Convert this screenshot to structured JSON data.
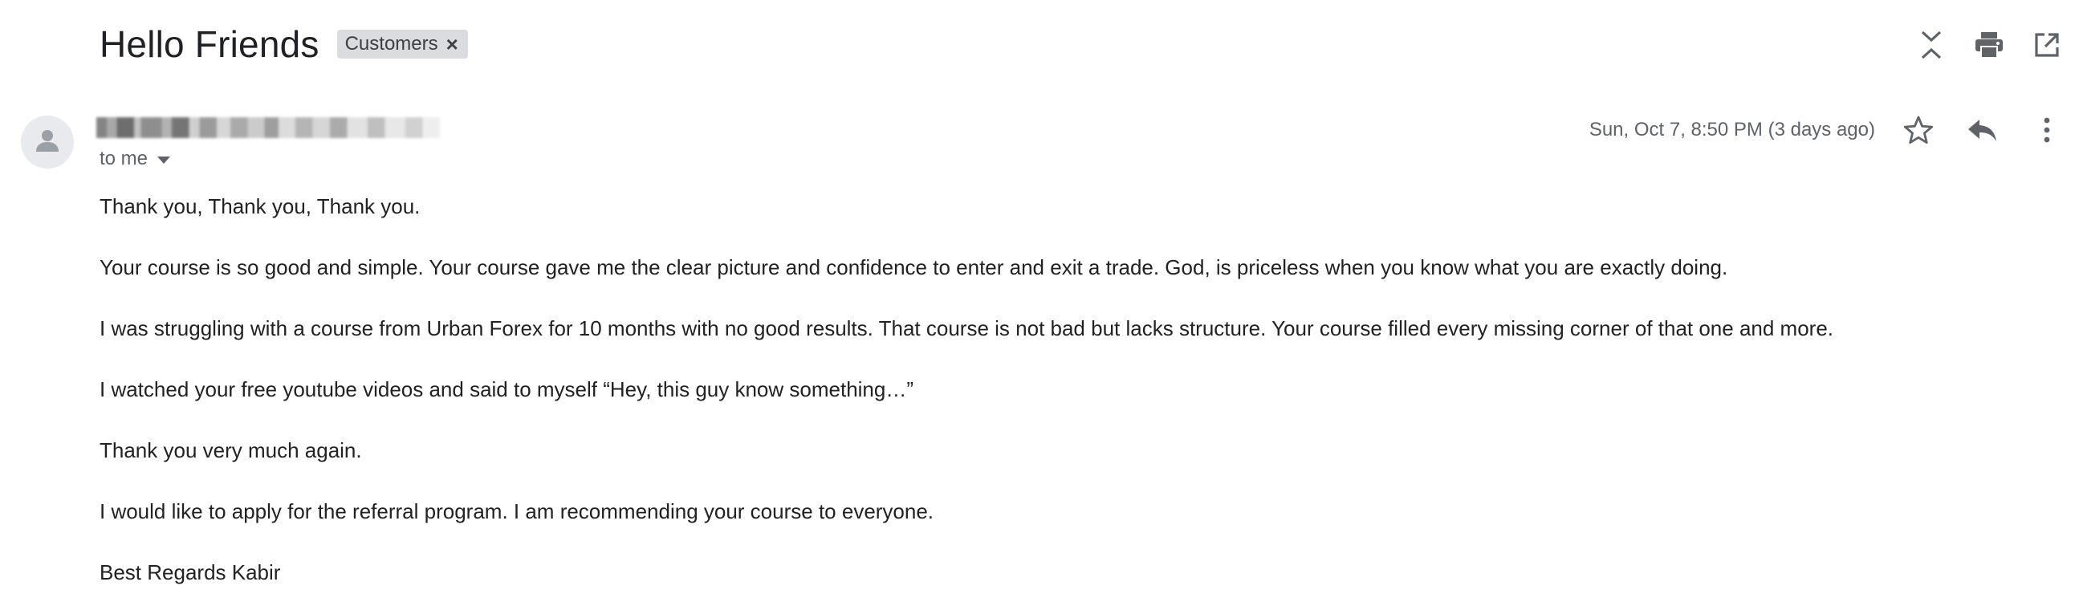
{
  "header": {
    "subject": "Hello Friends",
    "label": "Customers",
    "label_remove_glyph": "×",
    "actions": [
      "collapse-all-icon",
      "print-icon",
      "open-in-new-window-icon"
    ]
  },
  "message": {
    "recipient_label": "to me",
    "date": "Sun, Oct 7, 8:50 PM (3 days ago)",
    "actions": [
      "star-icon",
      "reply-icon",
      "more-vert-icon"
    ],
    "body": [
      "Thank you, Thank you, Thank you.",
      "Your course is so good and simple. Your course gave me the clear picture and confidence to enter and exit a trade. God, is priceless when you know what you are exactly doing.",
      "I was struggling with a course from Urban Forex for 10 months with no good results. That course is not bad but lacks structure. Your course filled every missing corner of that one and more.",
      "I watched your free youtube videos and said to myself “Hey, this guy know something…”",
      "Thank you very much again.",
      "I would like to apply for the referral program. I am recommending your course to everyone.",
      "Best Regards Kabir"
    ]
  },
  "colors": {
    "icon": "#5f6368",
    "text": "#202124",
    "chip_bg": "#dadce0",
    "avatar_bg": "#e8eaed"
  }
}
